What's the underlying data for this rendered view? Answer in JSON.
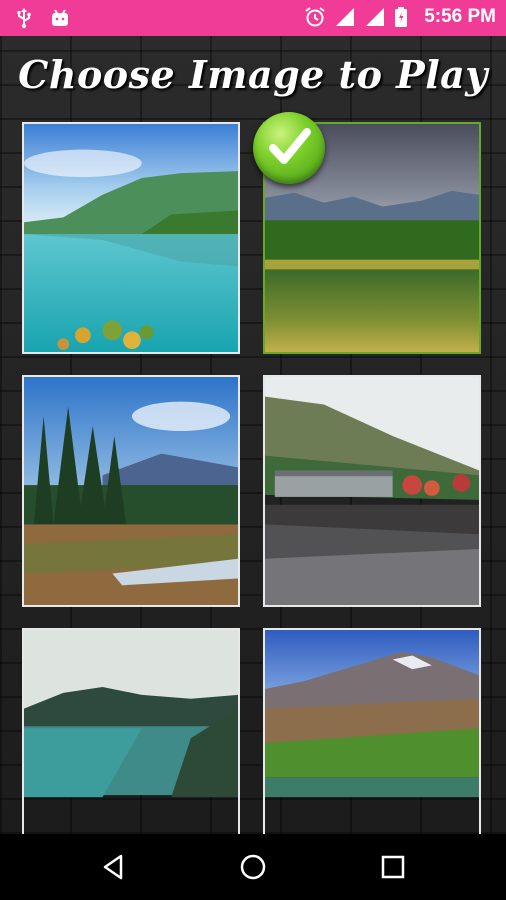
{
  "status_bar": {
    "time": "5:56 PM",
    "left_icons": [
      "usb-icon",
      "android-notification-icon"
    ],
    "right_icons": [
      "alarm-icon",
      "signal-icon",
      "signal-icon-2",
      "battery-icon"
    ],
    "background_color": "#f03c97"
  },
  "header": {
    "title": "Choose Image to Play"
  },
  "gallery": {
    "images": [
      {
        "name": "mountain-lake-turquoise",
        "selected": false
      },
      {
        "name": "mountain-lake-green-reflection",
        "selected": true
      },
      {
        "name": "pine-forest-meadow",
        "selected": false
      },
      {
        "name": "lakeside-building-autumn",
        "selected": false
      },
      {
        "name": "turquoise-river-hills",
        "selected": false
      },
      {
        "name": "rocky-mountain-green-valley",
        "selected": false
      }
    ],
    "selected_marker": "check-icon"
  },
  "nav_bar": {
    "buttons": [
      "back-icon",
      "home-icon",
      "recents-icon"
    ]
  }
}
